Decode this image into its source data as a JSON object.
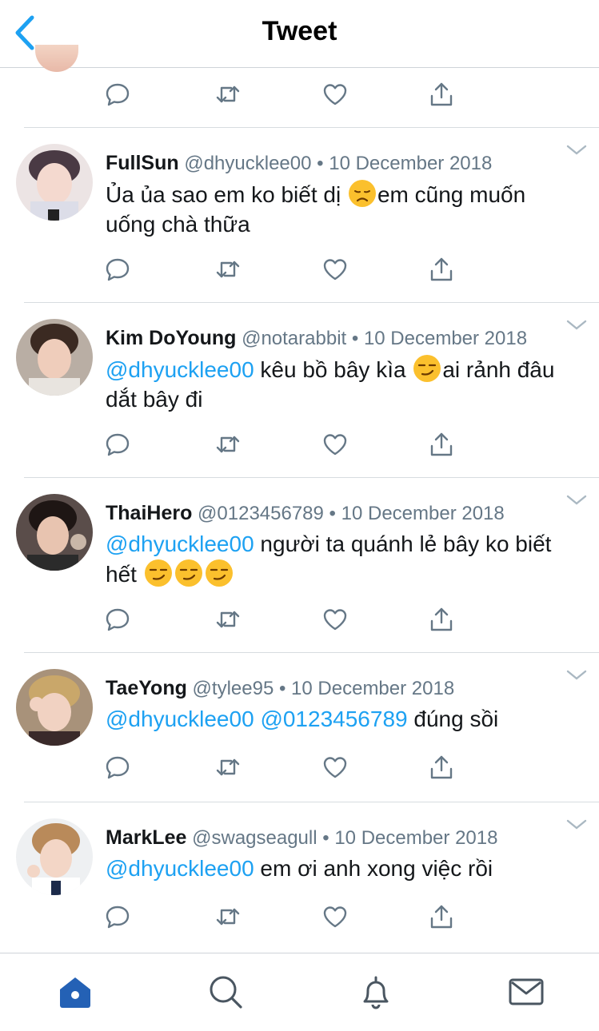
{
  "header": {
    "title": "Tweet"
  },
  "colors": {
    "accent": "#1da1f2",
    "muted": "#657786",
    "tab_active": "#2461b5"
  },
  "tweets": [
    {
      "name": "FullSun",
      "handle": "@dhyucklee00",
      "dot": "•",
      "date": "10 December 2018",
      "text_part1": "Ủa ủa sao em ko biết dị ",
      "text_part2": "em cũng muốn uống chà thữa"
    },
    {
      "name": "Kim DoYoung",
      "handle": "@notarabbit",
      "dot": "•",
      "date": "10 December 2018",
      "mention": "@dhyucklee00",
      "text_part1": " kêu bồ bây kìa ",
      "text_part2": "ai rảnh đâu dắt bây đi"
    },
    {
      "name": "ThaiHero",
      "handle": "@0123456789",
      "dot": "•",
      "date": "10 December 2018",
      "mention": "@dhyucklee00",
      "text_part1": " người ta quánh lẻ bây ko biết hết "
    },
    {
      "name": "TaeYong",
      "handle": "@tylee95",
      "dot": "•",
      "date": "10 December 2018",
      "mention": "@dhyucklee00",
      "mention2": "@0123456789",
      "text_part1": " đúng sồi"
    },
    {
      "name": "MarkLee",
      "handle": "@swagseagull",
      "dot": "•",
      "date": "10 December 2018",
      "mention": "@dhyucklee00",
      "text_part1": " em ơi anh xong việc rồi"
    }
  ],
  "icons": {
    "reply": "reply-icon",
    "retweet": "retweet-icon",
    "like": "heart-icon",
    "share": "share-icon",
    "tabs": [
      "home-icon",
      "search-icon",
      "bell-icon",
      "mail-icon"
    ]
  }
}
